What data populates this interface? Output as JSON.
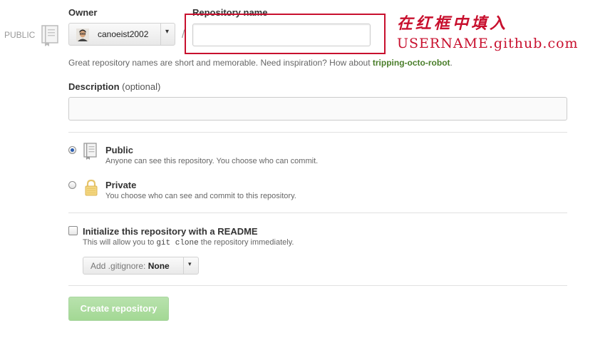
{
  "side": {
    "public_label": "PUBLIC",
    "icon": "repo-book-icon"
  },
  "owner": {
    "label": "Owner",
    "name": "canoeist2002",
    "avatar": "avatar",
    "caret": "▾"
  },
  "slash": "/",
  "repo_name": {
    "label": "Repository name",
    "value": "",
    "placeholder": ""
  },
  "annotation": {
    "line1": "在红框中填入",
    "line2": "USERNAME.github.com",
    "color": "#c8102e"
  },
  "hint": {
    "prefix": "Great repository names are short and memorable. Need inspiration? How about ",
    "suggestion": "tripping-octo-robot",
    "suffix": "."
  },
  "description": {
    "label": "Description",
    "optional": "(optional)",
    "value": "",
    "placeholder": ""
  },
  "visibility": {
    "selected": "public",
    "public": {
      "title": "Public",
      "desc": "Anyone can see this repository. You choose who can commit.",
      "icon": "repo-book-icon"
    },
    "private": {
      "title": "Private",
      "desc": "You choose who can see and commit to this repository.",
      "icon": "lock-icon"
    }
  },
  "readme": {
    "checked": false,
    "title": "Initialize this repository with a README",
    "desc_prefix": "This will allow you to ",
    "desc_code": "git clone",
    "desc_suffix": " the repository immediately."
  },
  "gitignore": {
    "label": "Add .gitignore:",
    "value": "None",
    "caret": "▾"
  },
  "create_button": {
    "label": "Create repository",
    "color": "#a3d894"
  }
}
